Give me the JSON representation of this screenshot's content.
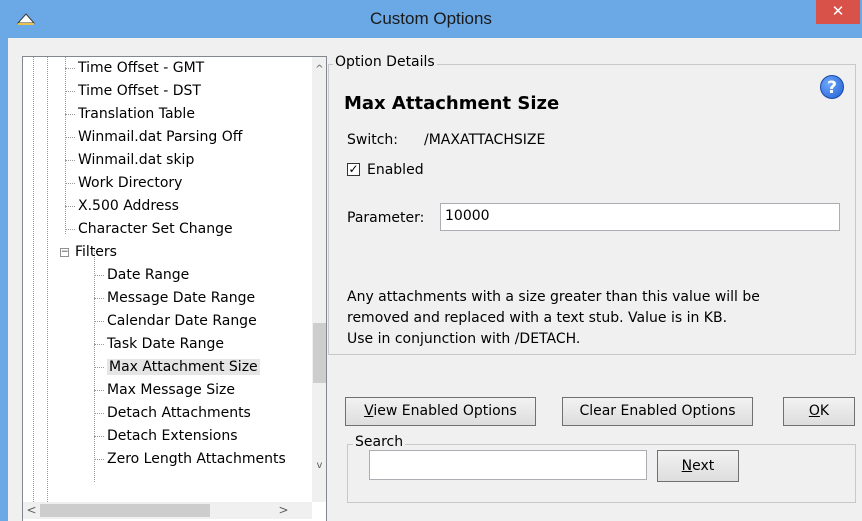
{
  "window": {
    "title": "Custom Options",
    "close_glyph": "✕"
  },
  "tree": {
    "items": [
      {
        "label": "Time Offset - GMT",
        "level": 2
      },
      {
        "label": "Time Offset - DST",
        "level": 2
      },
      {
        "label": "Translation Table",
        "level": 2
      },
      {
        "label": "Winmail.dat Parsing Off",
        "level": 2
      },
      {
        "label": "Winmail.dat skip",
        "level": 2
      },
      {
        "label": "Work Directory",
        "level": 2
      },
      {
        "label": "X.500 Address",
        "level": 2
      },
      {
        "label": "Character Set Change",
        "level": 2
      },
      {
        "label": "Filters",
        "level": 1,
        "expanded": true
      },
      {
        "label": "Date Range",
        "level": 3
      },
      {
        "label": "Message Date Range",
        "level": 3
      },
      {
        "label": "Calendar Date Range",
        "level": 3
      },
      {
        "label": "Task Date Range",
        "level": 3
      },
      {
        "label": "Max Attachment Size",
        "level": 3,
        "selected": true
      },
      {
        "label": "Max Message Size",
        "level": 3
      },
      {
        "label": "Detach Attachments",
        "level": 3
      },
      {
        "label": "Detach Extensions",
        "level": 3
      },
      {
        "label": "Zero Length Attachments",
        "level": 3
      }
    ],
    "expander_glyph": "−",
    "scroll_up_glyph": "^",
    "scroll_down_glyph": "v",
    "scroll_left_glyph": "<",
    "scroll_right_glyph": ">"
  },
  "details": {
    "group_label": "Option Details",
    "option_title": "Max Attachment Size",
    "switch_label": "Switch:",
    "switch_value": "/MAXATTACHSIZE",
    "enabled_label": "Enabled",
    "enabled_checked": true,
    "check_glyph": "✓",
    "help_glyph": "?",
    "parameter_label": "Parameter:",
    "parameter_value": "10000",
    "description_lines": [
      "Any attachments with a size greater than this value will be",
      "removed and replaced with a text stub. Value is in KB.",
      "Use in conjunction with /DETACH."
    ]
  },
  "buttons": {
    "view_enabled_mnemonic": "V",
    "view_enabled_rest": "iew Enabled Options",
    "clear_enabled": "Clear Enabled Options",
    "ok_mnemonic": "O",
    "ok_rest": "K",
    "next_mnemonic": "N",
    "next_rest": "ext"
  },
  "search": {
    "group_label": "Search",
    "value": ""
  },
  "colors": {
    "titlebar": "#6aa9e6",
    "close_button": "#d9524a",
    "selection": "#e5e5e5",
    "help_icon": "#1f5fd0"
  }
}
